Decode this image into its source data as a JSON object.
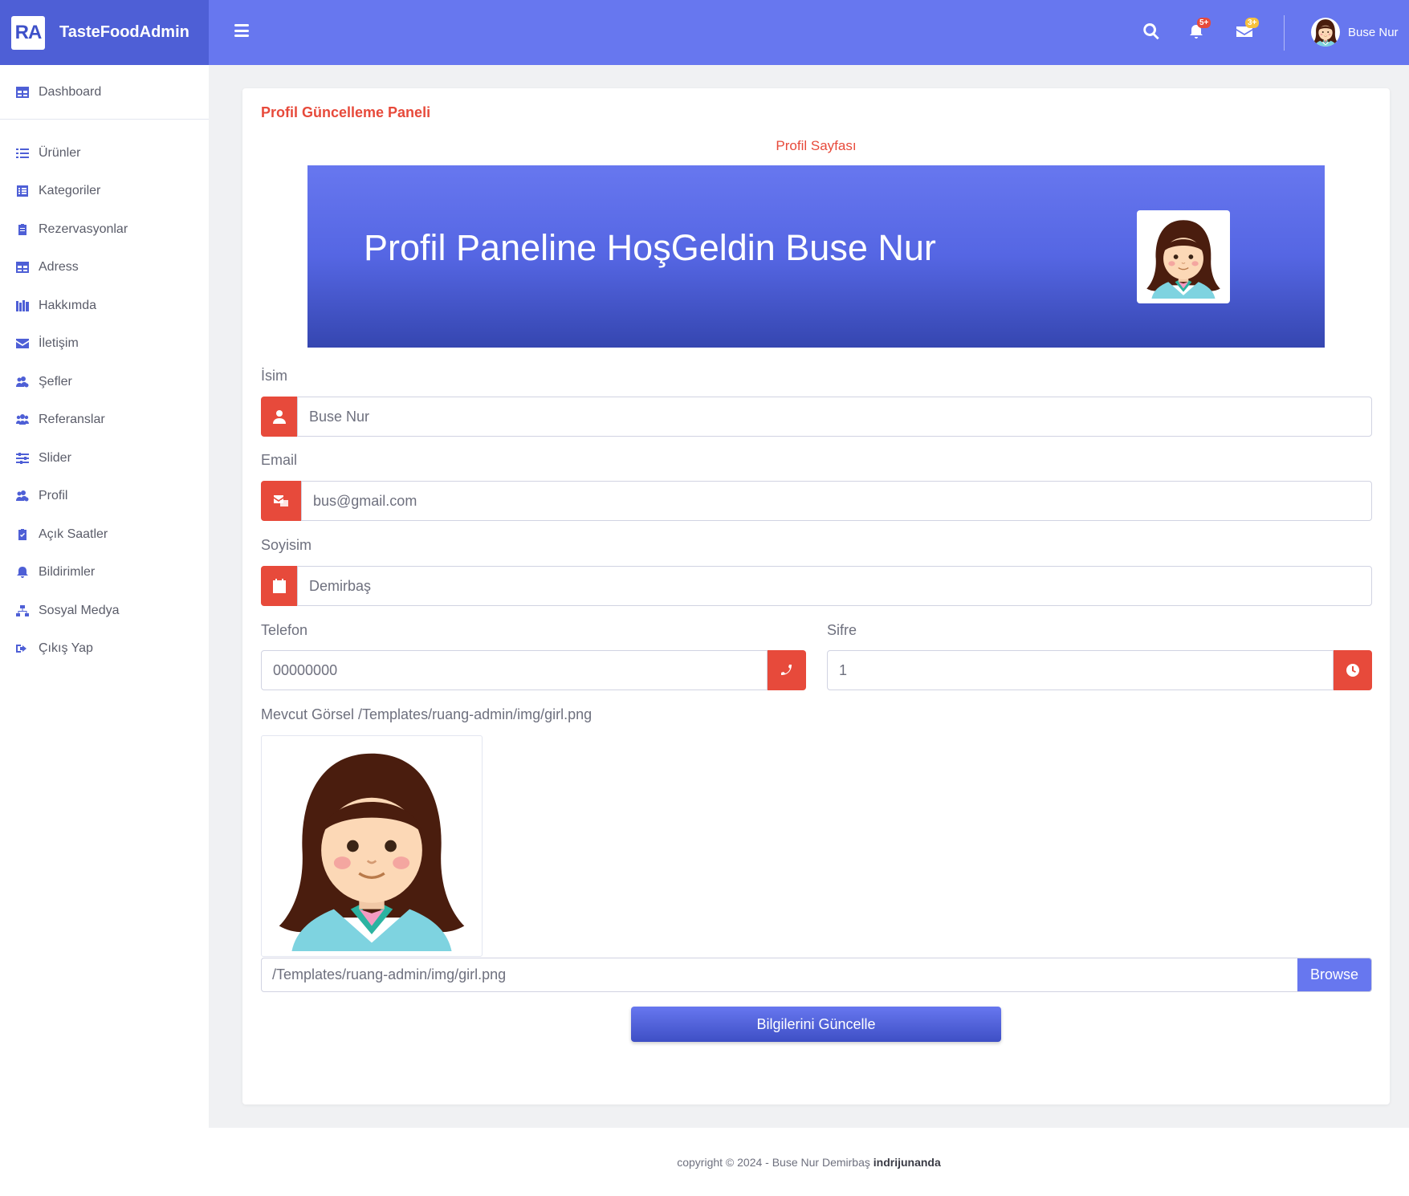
{
  "brand": {
    "logo": "RA",
    "name": "TasteFoodAdmin"
  },
  "sidebar": {
    "dashboard": "Dashboard",
    "items": [
      {
        "label": "Ürünler",
        "icon": "list-icon"
      },
      {
        "label": "Kategoriler",
        "icon": "list-alt-icon"
      },
      {
        "label": "Rezervasyonlar",
        "icon": "clipboard-icon"
      },
      {
        "label": "Adress",
        "icon": "table-icon"
      },
      {
        "label": "Hakkımda",
        "icon": "books-icon"
      },
      {
        "label": "İletişim",
        "icon": "envelope-icon"
      },
      {
        "label": "Şefler",
        "icon": "users-cog-icon"
      },
      {
        "label": "Referanslar",
        "icon": "users-icon"
      },
      {
        "label": "Slider",
        "icon": "sliders-icon"
      },
      {
        "label": "Profil",
        "icon": "users-cog-icon"
      },
      {
        "label": "Açık Saatler",
        "icon": "clipboard-check-icon"
      },
      {
        "label": "Bildirimler",
        "icon": "bell-icon"
      },
      {
        "label": "Sosyal Medya",
        "icon": "sitemap-icon"
      },
      {
        "label": "Çıkış Yap",
        "icon": "sign-out-icon"
      }
    ]
  },
  "topbar": {
    "alerts_badge": "5+",
    "messages_badge": "3+",
    "user_name": "Buse Nur",
    "colors": {
      "bar": "#6777ef",
      "alerts_badge": "#e74a3b",
      "messages_badge": "#f6c23e"
    }
  },
  "card": {
    "title": "Profil Güncelleme Paneli",
    "subtitle": "Profil Sayfası",
    "hero_text": "Profil Paneline HoşGeldin Buse Nur"
  },
  "form": {
    "name_label": "İsim",
    "name_value": "Buse Nur",
    "email_label": "Email",
    "email_value": "bus@gmail.com",
    "surname_label": "Soyisim",
    "surname_value": "Demirbaş",
    "phone_label": "Telefon",
    "phone_value": "00000000",
    "password_label": "Sifre",
    "password_value": "1",
    "image_label": "Mevcut Görsel /Templates/ruang-admin/img/girl.png",
    "file_path": "/Templates/ruang-admin/img/girl.png",
    "browse_label": "Browse",
    "submit_label": "Bilgilerini Güncelle"
  },
  "footer": {
    "text": "copyright © 2024 - Buse Nur Demirbaş",
    "link": "indrijunanda"
  }
}
